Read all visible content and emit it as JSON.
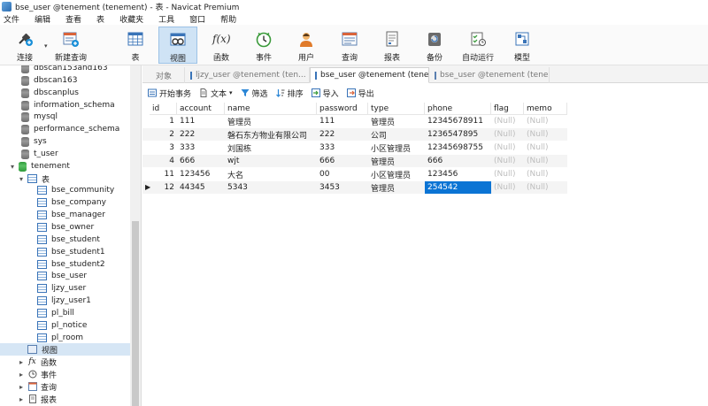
{
  "window": {
    "title": "bse_user @tenement (tenement) - 表 - Navicat Premium"
  },
  "menubar": {
    "items": [
      "文件",
      "编辑",
      "查看",
      "表",
      "收藏夹",
      "工具",
      "窗口",
      "帮助"
    ]
  },
  "toolbar": {
    "connect": "连接",
    "new_query": "新建查询",
    "table": "表",
    "view": "视图",
    "function": "函数",
    "event": "事件",
    "user": "用户",
    "query": "查询",
    "report": "报表",
    "backup": "备份",
    "automation": "自动运行",
    "model": "模型",
    "function_glyph": "f(x)",
    "dropdown_glyph": "▾"
  },
  "sidebar": {
    "databases_top": [
      "dbscan153and163",
      "dbscan163",
      "dbscanplus",
      "information_schema",
      "mysql",
      "performance_schema",
      "sys",
      "t_user"
    ],
    "tenement": "tenement",
    "tables_group": "表",
    "tables": [
      "bse_community",
      "bse_company",
      "bse_manager",
      "bse_owner",
      "bse_student",
      "bse_student1",
      "bse_student2",
      "bse_user",
      "ljzy_user",
      "ljzy_user1",
      "pl_bill",
      "pl_notice",
      "pl_room"
    ],
    "views_group": "视图",
    "functions_group": "函数",
    "events_group": "事件",
    "queries_group": "查询",
    "reports_group": "报表",
    "expand_glyph": "▸",
    "collapse_glyph": "▾",
    "fx_glyph": "fx"
  },
  "tabs": [
    {
      "label": "对象"
    },
    {
      "label": "ljzy_user @tenement (ten..."
    },
    {
      "label": "bse_user @tenement (tene..."
    },
    {
      "label": "bse_user @tenement (tene..."
    }
  ],
  "actions": {
    "begin_transaction": "开始事务",
    "text": "文本",
    "filter": "筛选",
    "sort": "排序",
    "import": "导入",
    "export": "导出",
    "text_dropdown": "▾"
  },
  "grid": {
    "columns": [
      "id",
      "account",
      "name",
      "password",
      "type",
      "phone",
      "flag",
      "memo"
    ],
    "rows": [
      {
        "id": "1",
        "account": "111",
        "name": "管理员",
        "password": "111",
        "type": "管理员",
        "phone": "12345678911",
        "flag": "(Null)",
        "memo": "(Null)"
      },
      {
        "id": "2",
        "account": "222",
        "name": "磐石东方物业有限公司",
        "password": "222",
        "type": "公司",
        "phone": "1236547895",
        "flag": "(Null)",
        "memo": "(Null)"
      },
      {
        "id": "3",
        "account": "333",
        "name": "刘国栋",
        "password": "333",
        "type": "小区管理员",
        "phone": "12345698755",
        "flag": "(Null)",
        "memo": "(Null)"
      },
      {
        "id": "4",
        "account": "666",
        "name": "wjt",
        "password": "666",
        "type": "管理员",
        "phone": "666",
        "flag": "(Null)",
        "memo": "(Null)"
      },
      {
        "id": "11",
        "account": "123456",
        "name": "大名",
        "password": "00",
        "type": "小区管理员",
        "phone": "123456",
        "flag": "(Null)",
        "memo": "(Null)"
      },
      {
        "id": "12",
        "account": "44345",
        "name": "5343",
        "password": "3453",
        "type": "管理员",
        "phone": "254542",
        "flag": "(Null)",
        "memo": "(Null)"
      }
    ],
    "current_row_marker": "▶"
  }
}
